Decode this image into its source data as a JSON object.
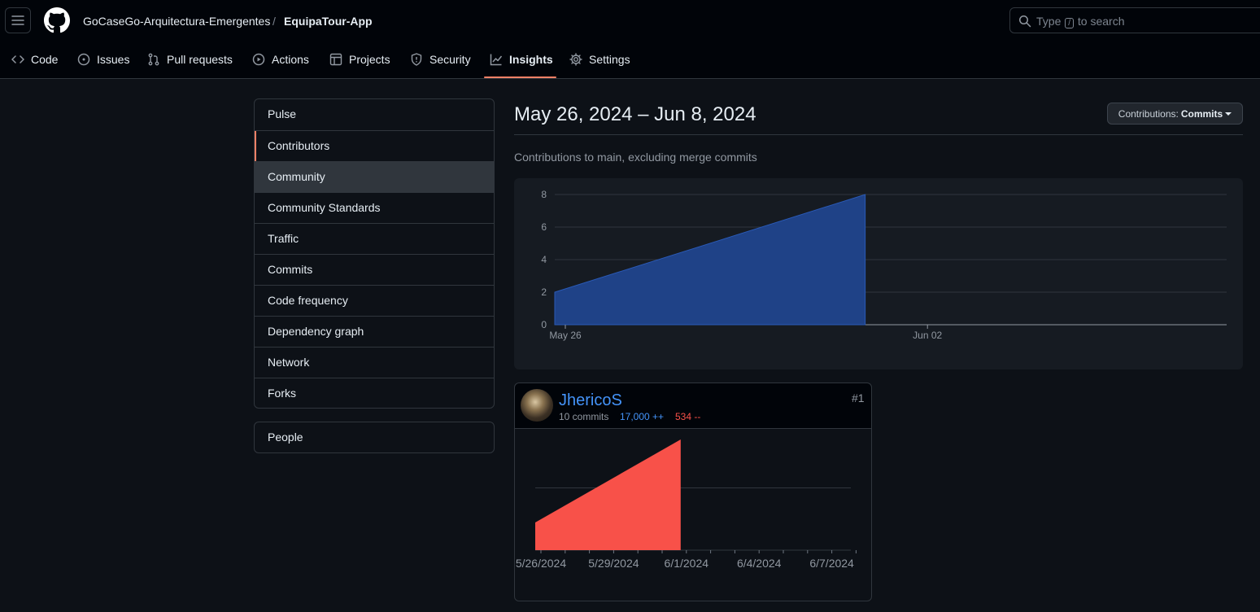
{
  "header": {
    "owner": "GoCaseGo-Arquitectura-Emergentes",
    "separator": "/",
    "repo": "EquipaTour-App",
    "search": {
      "prefix": "Type",
      "key": "/",
      "suffix": "to search"
    }
  },
  "nav": [
    {
      "label": "Code",
      "icon": "code-icon"
    },
    {
      "label": "Issues",
      "icon": "issue-icon"
    },
    {
      "label": "Pull requests",
      "icon": "pull-request-icon"
    },
    {
      "label": "Actions",
      "icon": "play-icon"
    },
    {
      "label": "Projects",
      "icon": "table-icon"
    },
    {
      "label": "Security",
      "icon": "shield-icon"
    },
    {
      "label": "Insights",
      "icon": "graph-icon",
      "active": true
    },
    {
      "label": "Settings",
      "icon": "gear-icon"
    }
  ],
  "sidebar": {
    "items": [
      {
        "label": "Pulse"
      },
      {
        "label": "Contributors",
        "selected": true
      },
      {
        "label": "Community",
        "hovered": true
      },
      {
        "label": "Community Standards"
      },
      {
        "label": "Traffic"
      },
      {
        "label": "Commits"
      },
      {
        "label": "Code frequency"
      },
      {
        "label": "Dependency graph"
      },
      {
        "label": "Network"
      },
      {
        "label": "Forks"
      }
    ],
    "people": "People"
  },
  "main": {
    "title": "May 26, 2024 – Jun 8, 2024",
    "contrib_label": "Contributions:",
    "contrib_value": "Commits",
    "subtitle": "Contributions to main, excluding merge commits"
  },
  "contributor": {
    "username": "JhericoS",
    "commits": "10 commits",
    "additions": "17,000 ++",
    "deletions": "534 --",
    "rank": "#1"
  },
  "colors": {
    "accent": "#f78166",
    "area_main": "#1f4287",
    "area_user": "#f85149",
    "link": "#4493f8"
  },
  "chart_data": [
    {
      "type": "area",
      "x": [
        "2024-05-26",
        "2024-06-01"
      ],
      "y": [
        2,
        8
      ],
      "x_tick_labels": [
        "May 26",
        "Jun 02"
      ],
      "y_ticks": [
        0,
        2,
        4,
        6,
        8
      ],
      "ylim": [
        0,
        8
      ],
      "xlim": [
        "2024-05-26",
        "2024-06-08"
      ],
      "grid": true
    },
    {
      "type": "area",
      "x": [
        "2024-05-26",
        "2024-06-01"
      ],
      "y": [
        2,
        8
      ],
      "x_tick_labels": [
        "5/26/2024",
        "5/29/2024",
        "6/1/2024",
        "6/4/2024",
        "6/7/2024"
      ],
      "ylim": [
        0,
        8
      ],
      "grid": true
    }
  ]
}
